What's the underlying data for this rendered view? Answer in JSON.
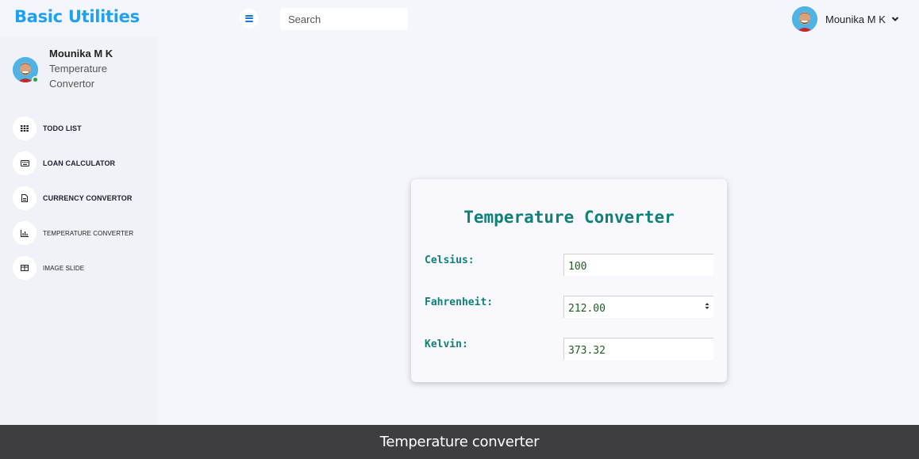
{
  "app": {
    "brand": "Basic Utilities"
  },
  "header": {
    "search_placeholder": "Search",
    "user_name": "Mounika M K"
  },
  "sidebar": {
    "profile": {
      "name": "Mounika M K",
      "role": "Temperature Convertor"
    },
    "items": [
      {
        "label": "TODO LIST",
        "icon": "grid-icon"
      },
      {
        "label": "LOAN CALCULATOR",
        "icon": "keyboard-icon"
      },
      {
        "label": "CURRENCY CONVERTOR",
        "icon": "document-icon"
      },
      {
        "label": "TEMPERATURE CONVERTER",
        "icon": "bar-chart-icon"
      },
      {
        "label": "IMAGE SLIDE",
        "icon": "table-icon"
      }
    ]
  },
  "converter": {
    "title": "Temperature Converter",
    "celsius_label": "Celsius:",
    "celsius_value": "100",
    "fahrenheit_label": "Fahrenheit:",
    "fahrenheit_value": "212.00",
    "kelvin_label": "Kelvin:",
    "kelvin_value": "373.32"
  },
  "footer": {
    "text": "Temperature converter"
  },
  "colors": {
    "brand": "#1da1f2",
    "accent_teal": "#12807a",
    "value_green": "#1b5e20",
    "footer_bg": "#3e3e41",
    "status_online": "#2e9e4a"
  }
}
